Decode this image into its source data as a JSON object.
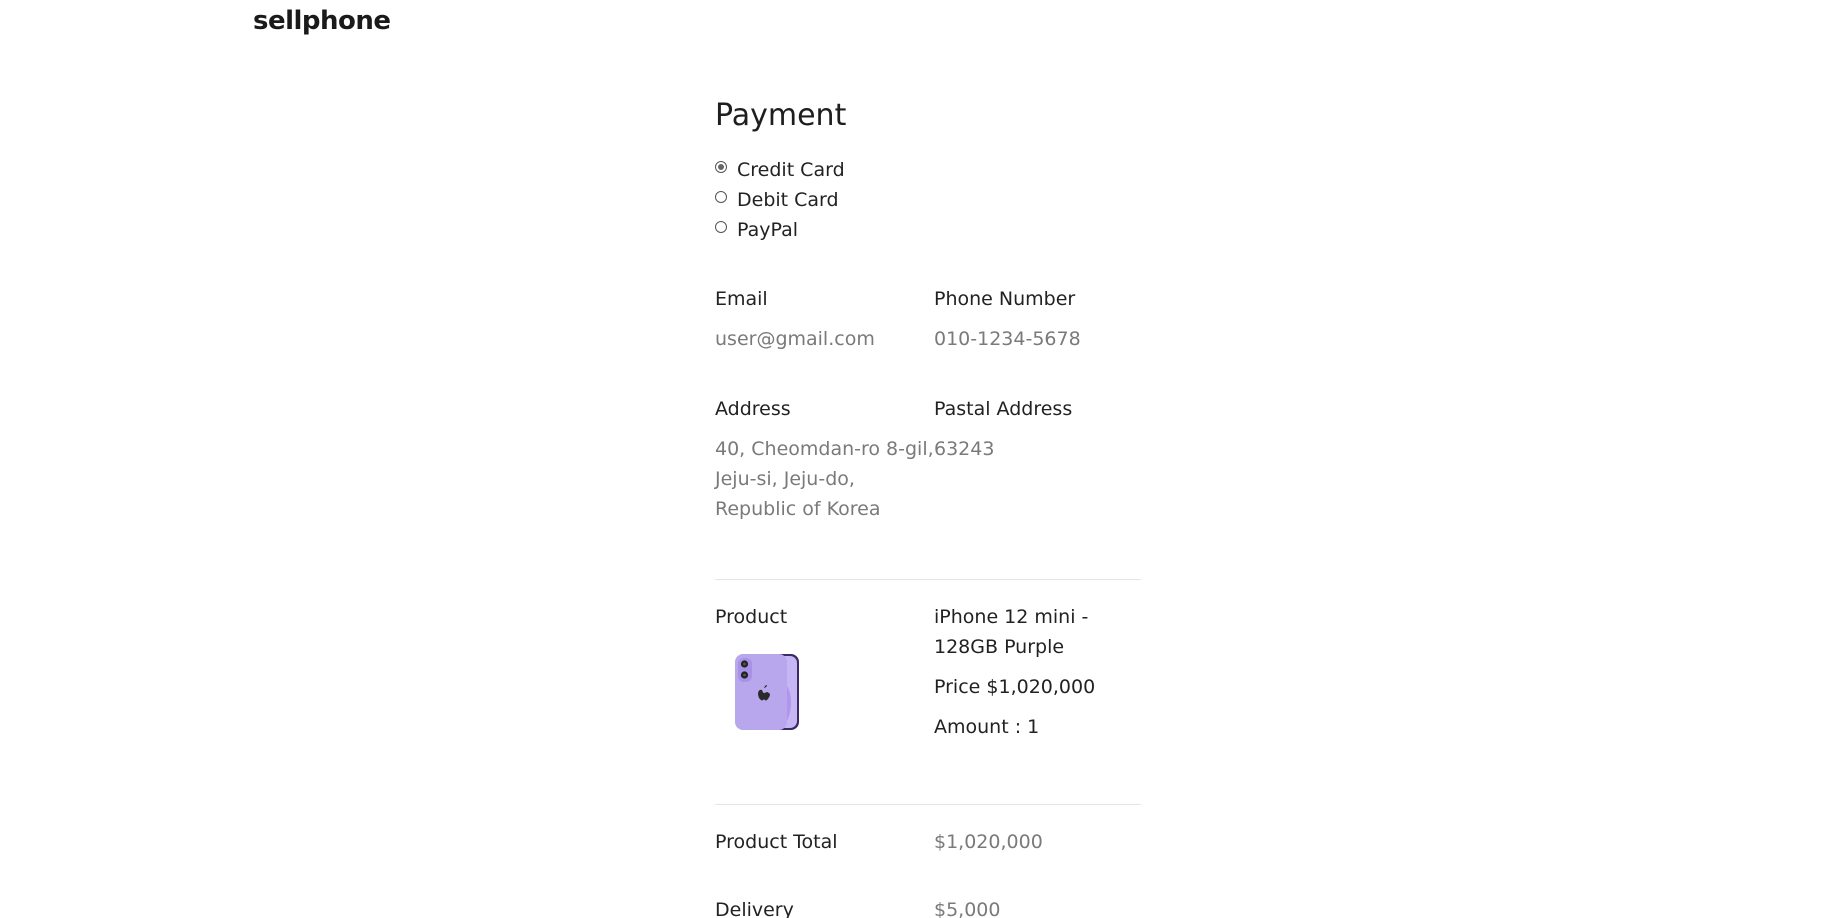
{
  "header": {
    "logo": "sellphone"
  },
  "payment": {
    "title": "Payment",
    "methods": [
      {
        "label": "Credit Card",
        "selected": true
      },
      {
        "label": "Debit Card",
        "selected": false
      },
      {
        "label": "PayPal",
        "selected": false
      }
    ]
  },
  "contact": {
    "email_label": "Email",
    "email_value": "user@gmail.com",
    "phone_label": "Phone Number",
    "phone_value": "010-1234-5678"
  },
  "address": {
    "address_label": "Address",
    "address_lines": [
      "40, Cheomdan-ro 8-gil,",
      "Jeju-si, Jeju-do,",
      "Republic of Korea"
    ],
    "postal_label": "Pastal Address",
    "postal_value": "63243"
  },
  "product": {
    "label": "Product",
    "name_lines": [
      "iPhone 12 mini -",
      "128GB Purple"
    ],
    "price": "Price $1,020,000",
    "amount": "Amount : 1",
    "image_icon": "iphone-purple-image"
  },
  "totals": {
    "product_total_label": "Product Total",
    "product_total_value": "$1,020,000",
    "delivery_label": "Delivery",
    "delivery_value": "$5,000"
  },
  "colors": {
    "text": "#222222",
    "muted": "#7a7a7a",
    "divider": "#e5e5e5",
    "phone_purple": "#b9a7ee"
  }
}
